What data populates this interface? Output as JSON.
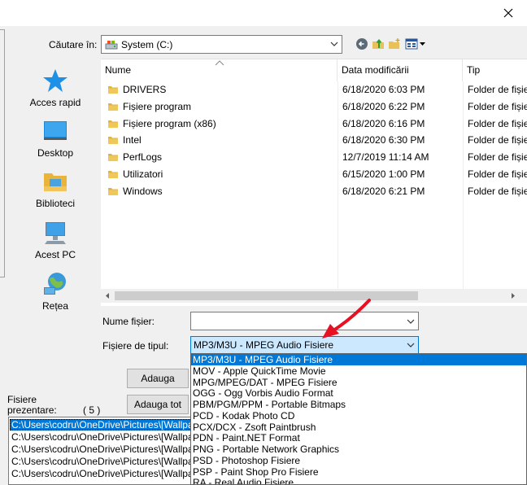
{
  "colors": {
    "accent": "#0078d7",
    "selection_light": "#cce8ff",
    "arrow": "#e81123",
    "folder": "#dcb34a"
  },
  "look_in": {
    "label": "Căutare în:",
    "value": "System (C:)"
  },
  "toolbar": {
    "icons": [
      "back-icon",
      "up-folder-icon",
      "new-folder-icon",
      "view-menu-icon"
    ]
  },
  "places": [
    {
      "label": "Acces rapid",
      "icon": "star-icon"
    },
    {
      "label": "Desktop",
      "icon": "desktop-icon"
    },
    {
      "label": "Biblioteci",
      "icon": "libraries-icon"
    },
    {
      "label": "Acest PC",
      "icon": "computer-icon"
    },
    {
      "label": "Rețea",
      "icon": "network-icon"
    }
  ],
  "columns": {
    "name": "Nume",
    "date": "Data modificării",
    "type": "Tip"
  },
  "files": [
    {
      "name": "DRIVERS",
      "date": "6/18/2020 6:03 PM",
      "type": "Folder de fișiere"
    },
    {
      "name": "Fișiere program",
      "date": "6/18/2020 6:22 PM",
      "type": "Folder de fișiere"
    },
    {
      "name": "Fișiere program (x86)",
      "date": "6/18/2020 6:16 PM",
      "type": "Folder de fișiere"
    },
    {
      "name": "Intel",
      "date": "6/18/2020 6:30 PM",
      "type": "Folder de fișiere"
    },
    {
      "name": "PerfLogs",
      "date": "12/7/2019 11:14 AM",
      "type": "Folder de fișiere"
    },
    {
      "name": "Utilizatori",
      "date": "6/15/2020 1:00 PM",
      "type": "Folder de fișiere"
    },
    {
      "name": "Windows",
      "date": "6/18/2020 6:21 PM",
      "type": "Folder de fișiere"
    }
  ],
  "filename": {
    "label": "Nume fișier:",
    "value": ""
  },
  "filetype": {
    "label": "Fișiere de tipul:",
    "value": "MP3/M3U - MPEG Audio Fisiere",
    "options": [
      "MP3/M3U - MPEG Audio Fisiere",
      "MOV - Apple QuickTime Movie",
      "MPG/MPEG/DAT - MPEG Fisiere",
      "OGG - Ogg Vorbis Audio Format",
      "PBM/PGM/PPM - Portable Bitmaps",
      "PCD - Kodak Photo CD",
      "PCX/DCX - Zsoft Paintbrush",
      "PDN - Paint.NET Format",
      "PNG - Portable Network Graphics",
      "PSD - Photoshop Fisiere",
      "PSP - Paint Shop Pro Fisiere",
      "RA - Real Audio Fisiere"
    ]
  },
  "buttons": {
    "add": "Adauga",
    "add_all": "Adauga tot"
  },
  "present": {
    "label_line1": "Fisiere",
    "label_line2": "prezentare:",
    "count": "( 5 )",
    "items": [
      "C:\\Users\\codru\\OneDrive\\Pictures\\[Wallpapers]",
      "C:\\Users\\codru\\OneDrive\\Pictures\\[Wallpapers]",
      "C:\\Users\\codru\\OneDrive\\Pictures\\[Wallpapers]",
      "C:\\Users\\codru\\OneDrive\\Pictures\\[Wallpapers]",
      "C:\\Users\\codru\\OneDrive\\Pictures\\[Wallpapers]"
    ]
  }
}
